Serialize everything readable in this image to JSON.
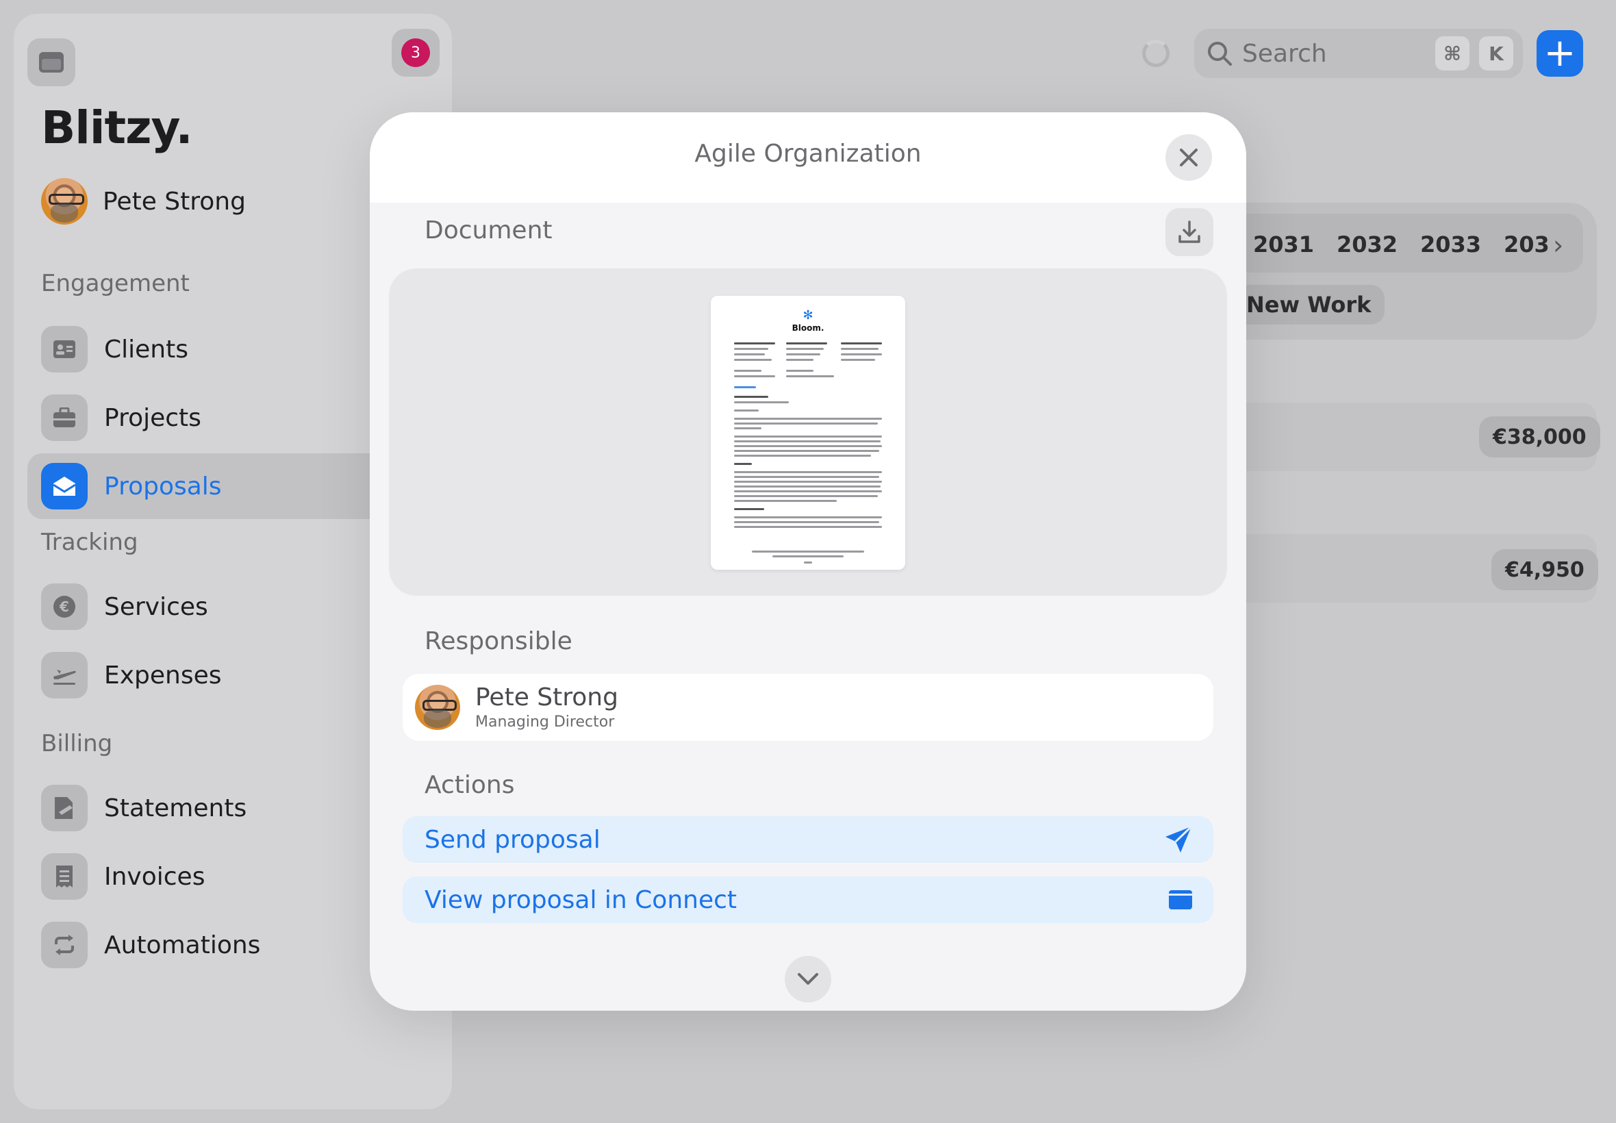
{
  "sidebar": {
    "notification_count": "3",
    "brand": "Blitzy.",
    "user_name": "Pete Strong",
    "sections": {
      "engagement": "Engagement",
      "tracking": "Tracking",
      "billing": "Billing"
    },
    "items": [
      {
        "label": "Clients",
        "icon": "contact-card-icon"
      },
      {
        "label": "Projects",
        "icon": "briefcase-icon"
      },
      {
        "label": "Proposals",
        "icon": "envelope-open-icon",
        "active": true
      },
      {
        "label": "Services",
        "icon": "euro-icon"
      },
      {
        "label": "Expenses",
        "icon": "airplane-icon"
      },
      {
        "label": "Statements",
        "icon": "document-sign-icon"
      },
      {
        "label": "Invoices",
        "icon": "receipt-icon"
      },
      {
        "label": "Automations",
        "icon": "repeat-icon"
      }
    ]
  },
  "topbar": {
    "search_placeholder": "Search",
    "shortcut_cmd": "⌘",
    "shortcut_key": "K",
    "add_label": "+"
  },
  "background": {
    "years": [
      "2031",
      "2032",
      "2033",
      "203"
    ],
    "filter_chip": "New Work",
    "amounts": [
      "€38,000",
      "€4,950"
    ]
  },
  "modal": {
    "title": "Agile Organization",
    "document_label": "Document",
    "document_preview": {
      "logo_name": "Bloom."
    },
    "responsible_label": "Responsible",
    "responsible": {
      "name": "Pete Strong",
      "role": "Managing Director"
    },
    "actions_label": "Actions",
    "actions": [
      {
        "label": "Send proposal",
        "icon": "paper-plane-icon"
      },
      {
        "label": "View proposal in Connect",
        "icon": "window-icon"
      }
    ]
  },
  "colors": {
    "accent": "#1a73e8",
    "badge": "#c8175d",
    "action_bg": "#e2effc"
  }
}
